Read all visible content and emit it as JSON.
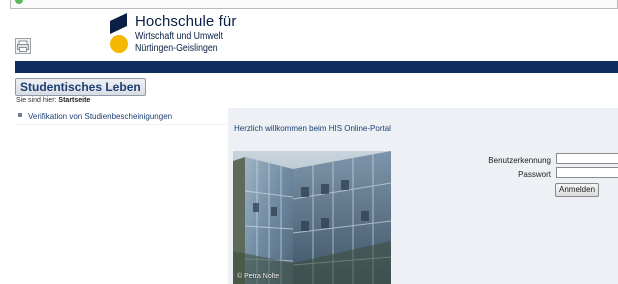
{
  "header": {
    "logo_line1": "Hochschule für",
    "logo_line2": "Wirtschaft und Umwelt",
    "logo_line3": "Nürtingen-Geislingen",
    "print_icon": "print-icon",
    "brand_colors": {
      "navy": "#0f2d5e",
      "yellow": "#f5b800",
      "light_panel": "#edf0f4"
    }
  },
  "section": {
    "title": "Studentisches Leben"
  },
  "breadcrumb": {
    "prefix": "Sie sind hier:",
    "current": "Startseite"
  },
  "sidebar": {
    "items": [
      {
        "label": "Verifikation von Studienbescheinigungen"
      }
    ]
  },
  "main": {
    "welcome": "Herzlich willkommen beim HIS Online-Portal",
    "photo_credit": "© Petra Nolte"
  },
  "login": {
    "username_label": "Benutzerkennung",
    "password_label": "Passwort",
    "username_value": "",
    "password_value": "",
    "submit_label": "Anmelden"
  }
}
